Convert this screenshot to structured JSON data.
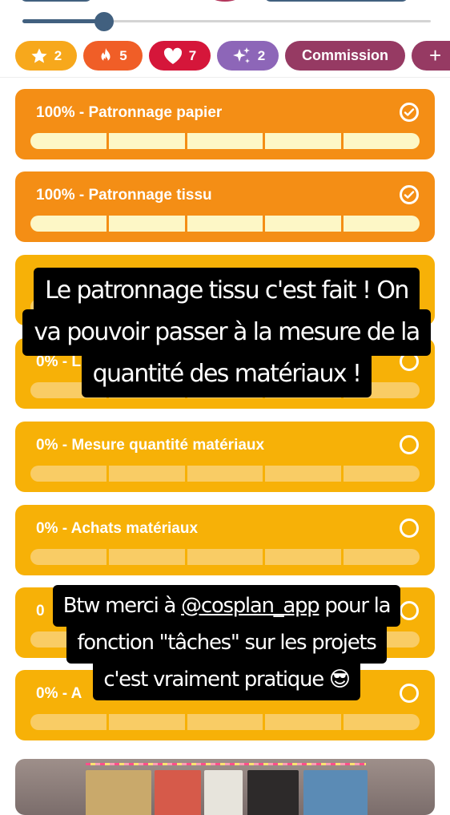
{
  "progress": {
    "slider_value": 0.2
  },
  "badges": [
    {
      "icon": "star-icon",
      "count": "2",
      "color": "#f7a81c"
    },
    {
      "icon": "fire-icon",
      "count": "5",
      "color": "#f05e27"
    },
    {
      "icon": "heart-icon",
      "count": "7",
      "color": "#d5163a"
    },
    {
      "icon": "sparkle-icon",
      "count": "2",
      "color": "#8d66b8"
    }
  ],
  "commission_label": "Commission",
  "add_label": "+",
  "tasks": [
    {
      "label": "100% - Patronnage papier",
      "status": "done",
      "segments": 5
    },
    {
      "label": "100% - Patronnage tissu",
      "status": "done",
      "segments": 5
    },
    {
      "label": "",
      "status": "todo",
      "segments": 5
    },
    {
      "label": "0% - L",
      "status": "todo",
      "segments": 5
    },
    {
      "label": "0% - Mesure quantité matériaux",
      "status": "todo",
      "segments": 5
    },
    {
      "label": "0% - Achats matériaux",
      "status": "todo",
      "segments": 5
    },
    {
      "label": "0",
      "status": "todo",
      "segments": 5
    },
    {
      "label": "0% - A",
      "status": "todo",
      "segments": 5
    }
  ],
  "captions": {
    "first": [
      "Le patronnage tissu c'est fait ! On",
      "va pouvoir passer à la mesure de la",
      "quantité des matériaux !"
    ],
    "second": {
      "line1_before": "Btw merci à ",
      "mention": "@cosplan_app",
      "line1_after": " pour la",
      "line2": "fonction \"tâches\" sur les projets",
      "line3": "c'est vraiment pratique 😎"
    }
  },
  "colors": {
    "accent": "#41607f",
    "task_done": "#f48e15",
    "task_todo": "#f7b107",
    "commission": "#963a63"
  }
}
